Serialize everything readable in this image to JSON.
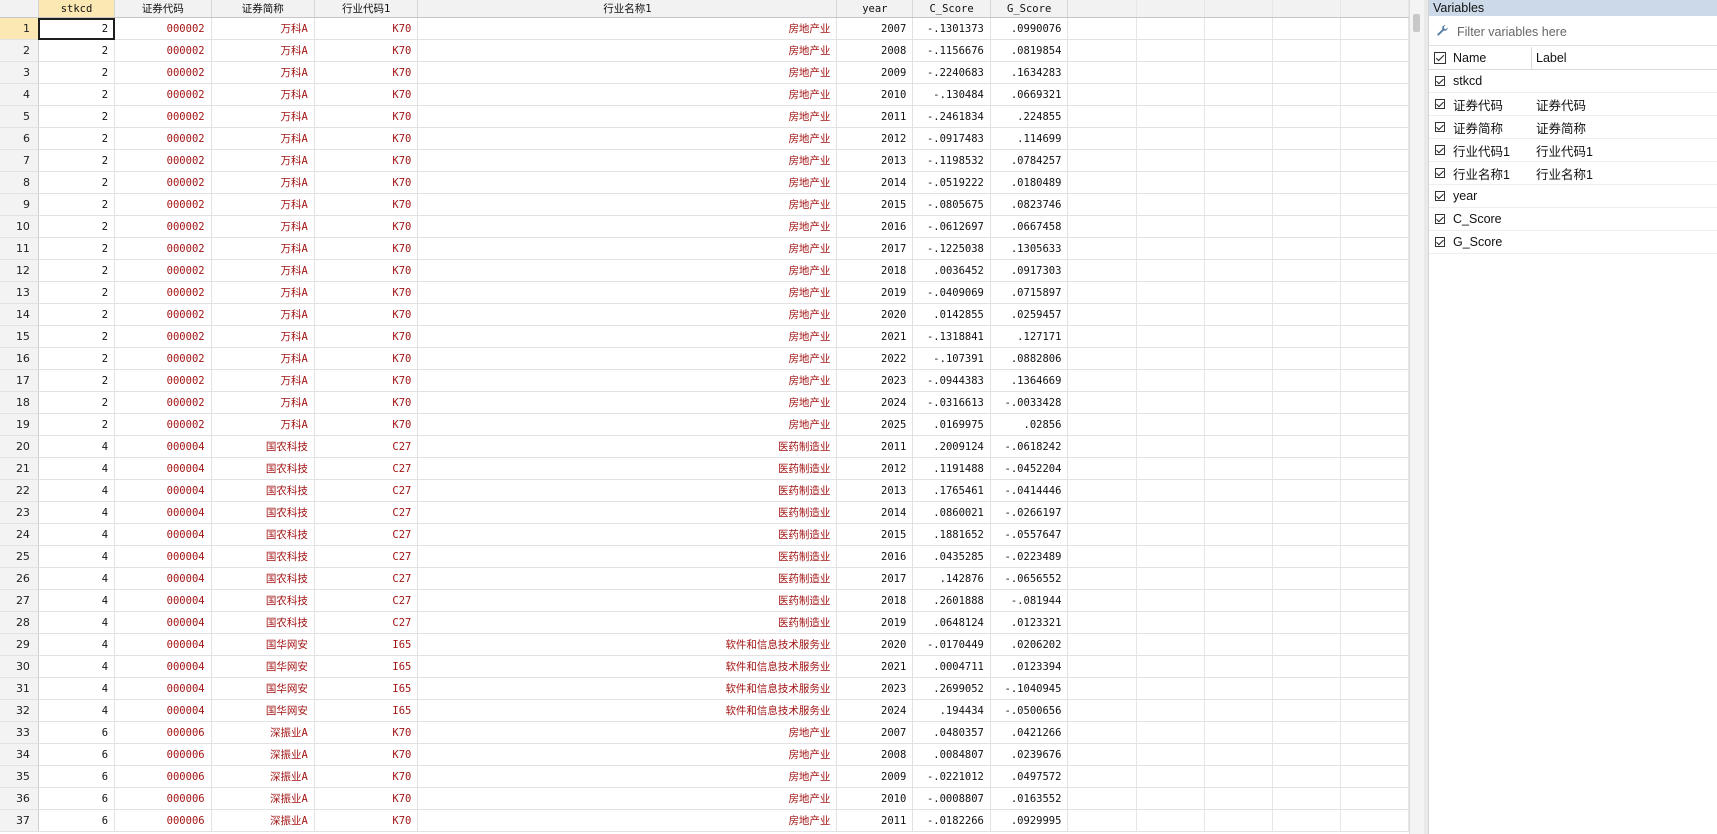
{
  "grid": {
    "columns": [
      {
        "key": "stkcd",
        "label": "stkcd"
      },
      {
        "key": "code",
        "label": "证券代码"
      },
      {
        "key": "abbr",
        "label": "证券简称"
      },
      {
        "key": "ind_code",
        "label": "行业代码1"
      },
      {
        "key": "ind_name",
        "label": "行业名称1"
      },
      {
        "key": "year",
        "label": "year"
      },
      {
        "key": "c_score",
        "label": "C_Score"
      },
      {
        "key": "g_score",
        "label": "G_Score"
      }
    ],
    "rows": [
      {
        "n": "1",
        "stkcd": "2",
        "code": "000002",
        "abbr": "万科A",
        "ind_code": "K70",
        "ind_name": "房地产业",
        "year": "2007",
        "c_score": "-.1301373",
        "g_score": ".0990076"
      },
      {
        "n": "2",
        "stkcd": "2",
        "code": "000002",
        "abbr": "万科A",
        "ind_code": "K70",
        "ind_name": "房地产业",
        "year": "2008",
        "c_score": "-.1156676",
        "g_score": ".0819854"
      },
      {
        "n": "3",
        "stkcd": "2",
        "code": "000002",
        "abbr": "万科A",
        "ind_code": "K70",
        "ind_name": "房地产业",
        "year": "2009",
        "c_score": "-.2240683",
        "g_score": ".1634283"
      },
      {
        "n": "4",
        "stkcd": "2",
        "code": "000002",
        "abbr": "万科A",
        "ind_code": "K70",
        "ind_name": "房地产业",
        "year": "2010",
        "c_score": "-.130484",
        "g_score": ".0669321"
      },
      {
        "n": "5",
        "stkcd": "2",
        "code": "000002",
        "abbr": "万科A",
        "ind_code": "K70",
        "ind_name": "房地产业",
        "year": "2011",
        "c_score": "-.2461834",
        "g_score": ".224855"
      },
      {
        "n": "6",
        "stkcd": "2",
        "code": "000002",
        "abbr": "万科A",
        "ind_code": "K70",
        "ind_name": "房地产业",
        "year": "2012",
        "c_score": "-.0917483",
        "g_score": ".114699"
      },
      {
        "n": "7",
        "stkcd": "2",
        "code": "000002",
        "abbr": "万科A",
        "ind_code": "K70",
        "ind_name": "房地产业",
        "year": "2013",
        "c_score": "-.1198532",
        "g_score": ".0784257"
      },
      {
        "n": "8",
        "stkcd": "2",
        "code": "000002",
        "abbr": "万科A",
        "ind_code": "K70",
        "ind_name": "房地产业",
        "year": "2014",
        "c_score": "-.0519222",
        "g_score": ".0180489"
      },
      {
        "n": "9",
        "stkcd": "2",
        "code": "000002",
        "abbr": "万科A",
        "ind_code": "K70",
        "ind_name": "房地产业",
        "year": "2015",
        "c_score": "-.0805675",
        "g_score": ".0823746"
      },
      {
        "n": "10",
        "stkcd": "2",
        "code": "000002",
        "abbr": "万科A",
        "ind_code": "K70",
        "ind_name": "房地产业",
        "year": "2016",
        "c_score": "-.0612697",
        "g_score": ".0667458"
      },
      {
        "n": "11",
        "stkcd": "2",
        "code": "000002",
        "abbr": "万科A",
        "ind_code": "K70",
        "ind_name": "房地产业",
        "year": "2017",
        "c_score": "-.1225038",
        "g_score": ".1305633"
      },
      {
        "n": "12",
        "stkcd": "2",
        "code": "000002",
        "abbr": "万科A",
        "ind_code": "K70",
        "ind_name": "房地产业",
        "year": "2018",
        "c_score": ".0036452",
        "g_score": ".0917303"
      },
      {
        "n": "13",
        "stkcd": "2",
        "code": "000002",
        "abbr": "万科A",
        "ind_code": "K70",
        "ind_name": "房地产业",
        "year": "2019",
        "c_score": "-.0409069",
        "g_score": ".0715897"
      },
      {
        "n": "14",
        "stkcd": "2",
        "code": "000002",
        "abbr": "万科A",
        "ind_code": "K70",
        "ind_name": "房地产业",
        "year": "2020",
        "c_score": ".0142855",
        "g_score": ".0259457"
      },
      {
        "n": "15",
        "stkcd": "2",
        "code": "000002",
        "abbr": "万科A",
        "ind_code": "K70",
        "ind_name": "房地产业",
        "year": "2021",
        "c_score": "-.1318841",
        "g_score": ".127171"
      },
      {
        "n": "16",
        "stkcd": "2",
        "code": "000002",
        "abbr": "万科A",
        "ind_code": "K70",
        "ind_name": "房地产业",
        "year": "2022",
        "c_score": "-.107391",
        "g_score": ".0882806"
      },
      {
        "n": "17",
        "stkcd": "2",
        "code": "000002",
        "abbr": "万科A",
        "ind_code": "K70",
        "ind_name": "房地产业",
        "year": "2023",
        "c_score": "-.0944383",
        "g_score": ".1364669"
      },
      {
        "n": "18",
        "stkcd": "2",
        "code": "000002",
        "abbr": "万科A",
        "ind_code": "K70",
        "ind_name": "房地产业",
        "year": "2024",
        "c_score": "-.0316613",
        "g_score": "-.0033428"
      },
      {
        "n": "19",
        "stkcd": "2",
        "code": "000002",
        "abbr": "万科A",
        "ind_code": "K70",
        "ind_name": "房地产业",
        "year": "2025",
        "c_score": ".0169975",
        "g_score": ".02856"
      },
      {
        "n": "20",
        "stkcd": "4",
        "code": "000004",
        "abbr": "国农科技",
        "ind_code": "C27",
        "ind_name": "医药制造业",
        "year": "2011",
        "c_score": ".2009124",
        "g_score": "-.0618242"
      },
      {
        "n": "21",
        "stkcd": "4",
        "code": "000004",
        "abbr": "国农科技",
        "ind_code": "C27",
        "ind_name": "医药制造业",
        "year": "2012",
        "c_score": ".1191488",
        "g_score": "-.0452204"
      },
      {
        "n": "22",
        "stkcd": "4",
        "code": "000004",
        "abbr": "国农科技",
        "ind_code": "C27",
        "ind_name": "医药制造业",
        "year": "2013",
        "c_score": ".1765461",
        "g_score": "-.0414446"
      },
      {
        "n": "23",
        "stkcd": "4",
        "code": "000004",
        "abbr": "国农科技",
        "ind_code": "C27",
        "ind_name": "医药制造业",
        "year": "2014",
        "c_score": ".0860021",
        "g_score": "-.0266197"
      },
      {
        "n": "24",
        "stkcd": "4",
        "code": "000004",
        "abbr": "国农科技",
        "ind_code": "C27",
        "ind_name": "医药制造业",
        "year": "2015",
        "c_score": ".1881652",
        "g_score": "-.0557647"
      },
      {
        "n": "25",
        "stkcd": "4",
        "code": "000004",
        "abbr": "国农科技",
        "ind_code": "C27",
        "ind_name": "医药制造业",
        "year": "2016",
        "c_score": ".0435285",
        "g_score": "-.0223489"
      },
      {
        "n": "26",
        "stkcd": "4",
        "code": "000004",
        "abbr": "国农科技",
        "ind_code": "C27",
        "ind_name": "医药制造业",
        "year": "2017",
        "c_score": ".142876",
        "g_score": "-.0656552"
      },
      {
        "n": "27",
        "stkcd": "4",
        "code": "000004",
        "abbr": "国农科技",
        "ind_code": "C27",
        "ind_name": "医药制造业",
        "year": "2018",
        "c_score": ".2601888",
        "g_score": "-.081944"
      },
      {
        "n": "28",
        "stkcd": "4",
        "code": "000004",
        "abbr": "国农科技",
        "ind_code": "C27",
        "ind_name": "医药制造业",
        "year": "2019",
        "c_score": ".0648124",
        "g_score": ".0123321"
      },
      {
        "n": "29",
        "stkcd": "4",
        "code": "000004",
        "abbr": "国华网安",
        "ind_code": "I65",
        "ind_name": "软件和信息技术服务业",
        "year": "2020",
        "c_score": "-.0170449",
        "g_score": ".0206202"
      },
      {
        "n": "30",
        "stkcd": "4",
        "code": "000004",
        "abbr": "国华网安",
        "ind_code": "I65",
        "ind_name": "软件和信息技术服务业",
        "year": "2021",
        "c_score": ".0004711",
        "g_score": ".0123394"
      },
      {
        "n": "31",
        "stkcd": "4",
        "code": "000004",
        "abbr": "国华网安",
        "ind_code": "I65",
        "ind_name": "软件和信息技术服务业",
        "year": "2023",
        "c_score": ".2699052",
        "g_score": "-.1040945"
      },
      {
        "n": "32",
        "stkcd": "4",
        "code": "000004",
        "abbr": "国华网安",
        "ind_code": "I65",
        "ind_name": "软件和信息技术服务业",
        "year": "2024",
        "c_score": ".194434",
        "g_score": "-.0500656"
      },
      {
        "n": "33",
        "stkcd": "6",
        "code": "000006",
        "abbr": "深振业A",
        "ind_code": "K70",
        "ind_name": "房地产业",
        "year": "2007",
        "c_score": ".0480357",
        "g_score": ".0421266"
      },
      {
        "n": "34",
        "stkcd": "6",
        "code": "000006",
        "abbr": "深振业A",
        "ind_code": "K70",
        "ind_name": "房地产业",
        "year": "2008",
        "c_score": ".0084807",
        "g_score": ".0239676"
      },
      {
        "n": "35",
        "stkcd": "6",
        "code": "000006",
        "abbr": "深振业A",
        "ind_code": "K70",
        "ind_name": "房地产业",
        "year": "2009",
        "c_score": "-.0221012",
        "g_score": ".0497572"
      },
      {
        "n": "36",
        "stkcd": "6",
        "code": "000006",
        "abbr": "深振业A",
        "ind_code": "K70",
        "ind_name": "房地产业",
        "year": "2010",
        "c_score": "-.0008807",
        "g_score": ".0163552"
      },
      {
        "n": "37",
        "stkcd": "6",
        "code": "000006",
        "abbr": "深振业A",
        "ind_code": "K70",
        "ind_name": "房地产业",
        "year": "2011",
        "c_score": "-.0182266",
        "g_score": ".0929995"
      }
    ]
  },
  "variables_panel": {
    "title": "Variables",
    "filter_placeholder": "Filter variables here",
    "filter_icon": "wrench-icon",
    "header_name": "Name",
    "header_label": "Label",
    "items": [
      {
        "name": "stkcd",
        "label": ""
      },
      {
        "name": "证券代码",
        "label": "证券代码"
      },
      {
        "name": "证券简称",
        "label": "证券简称"
      },
      {
        "name": "行业代码1",
        "label": "行业代码1"
      },
      {
        "name": "行业名称1",
        "label": "行业名称1"
      },
      {
        "name": "year",
        "label": ""
      },
      {
        "name": "C_Score",
        "label": ""
      },
      {
        "name": "G_Score",
        "label": ""
      }
    ]
  },
  "colors": {
    "string_text": "#a31515",
    "highlight": "#fbe8b3",
    "panel_title_bg": "#cbd9e8"
  }
}
